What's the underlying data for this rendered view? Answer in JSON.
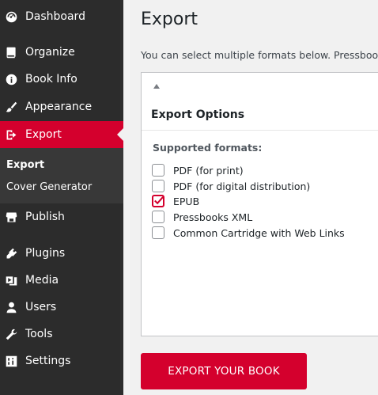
{
  "sidebar": {
    "items": [
      {
        "label": "Dashboard",
        "icon": "dashboard-icon"
      },
      {
        "label": "Organize",
        "icon": "book-icon"
      },
      {
        "label": "Book Info",
        "icon": "info-icon"
      },
      {
        "label": "Appearance",
        "icon": "paintbrush-icon"
      },
      {
        "label": "Export",
        "icon": "export-icon"
      },
      {
        "label": "Publish",
        "icon": "store-icon"
      },
      {
        "label": "Plugins",
        "icon": "plugin-icon"
      },
      {
        "label": "Media",
        "icon": "media-icon"
      },
      {
        "label": "Users",
        "icon": "user-icon"
      },
      {
        "label": "Tools",
        "icon": "wrench-icon"
      },
      {
        "label": "Settings",
        "icon": "settings-icon"
      }
    ],
    "submenu": [
      "Export",
      "Cover Generator"
    ]
  },
  "main": {
    "title": "Export",
    "intro": "You can select multiple formats below. Pressbooks",
    "panel": {
      "title": "Export Options",
      "formats_label": "Supported formats:",
      "formats": [
        {
          "label": "PDF (for print)",
          "checked": false
        },
        {
          "label": "PDF (for digital distribution)",
          "checked": false
        },
        {
          "label": "EPUB",
          "checked": true
        },
        {
          "label": "Pressbooks XML",
          "checked": false
        },
        {
          "label": "Common Cartridge with Web Links",
          "checked": false
        }
      ]
    },
    "export_button": "EXPORT YOUR BOOK"
  },
  "colors": {
    "accent": "#d4002d",
    "sidebar": "#2c2c2c"
  }
}
